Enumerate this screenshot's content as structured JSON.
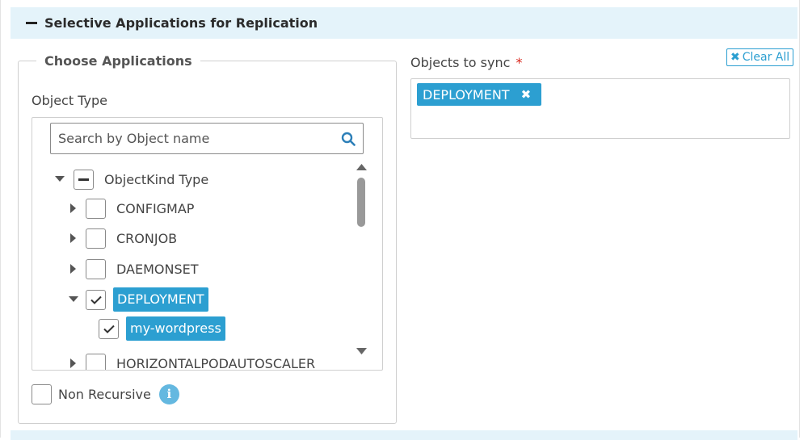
{
  "section": {
    "title": "Selective Applications for Replication"
  },
  "choose": {
    "legend": "Choose Applications",
    "object_type_label": "Object Type",
    "search": {
      "placeholder": "Search by Object name",
      "value": ""
    },
    "tree": {
      "root": {
        "label": "ObjectKind Type",
        "state": "indeterminate",
        "expanded": true
      },
      "items": [
        {
          "label": "CONFIGMAP",
          "checked": false,
          "expanded": false,
          "selected": false
        },
        {
          "label": "CRONJOB",
          "checked": false,
          "expanded": false,
          "selected": false
        },
        {
          "label": "DAEMONSET",
          "checked": false,
          "expanded": false,
          "selected": false
        },
        {
          "label": "DEPLOYMENT",
          "checked": true,
          "expanded": true,
          "selected": true,
          "children": [
            {
              "label": "my-wordpress",
              "checked": true,
              "selected": true
            }
          ]
        },
        {
          "label": "HORIZONTALPODAUTOSCALER",
          "checked": false,
          "expanded": false,
          "selected": false
        }
      ]
    },
    "non_recursive": {
      "label": "Non Recursive",
      "checked": false,
      "info_icon": "info-icon"
    }
  },
  "sync": {
    "label": "Objects to sync",
    "required_mark": "*",
    "clear_all": "Clear All",
    "chips": [
      {
        "label": "DEPLOYMENT"
      }
    ]
  },
  "colors": {
    "accent": "#2c9fd1",
    "header_bg": "#e4f3fa",
    "required": "#d9261c"
  }
}
